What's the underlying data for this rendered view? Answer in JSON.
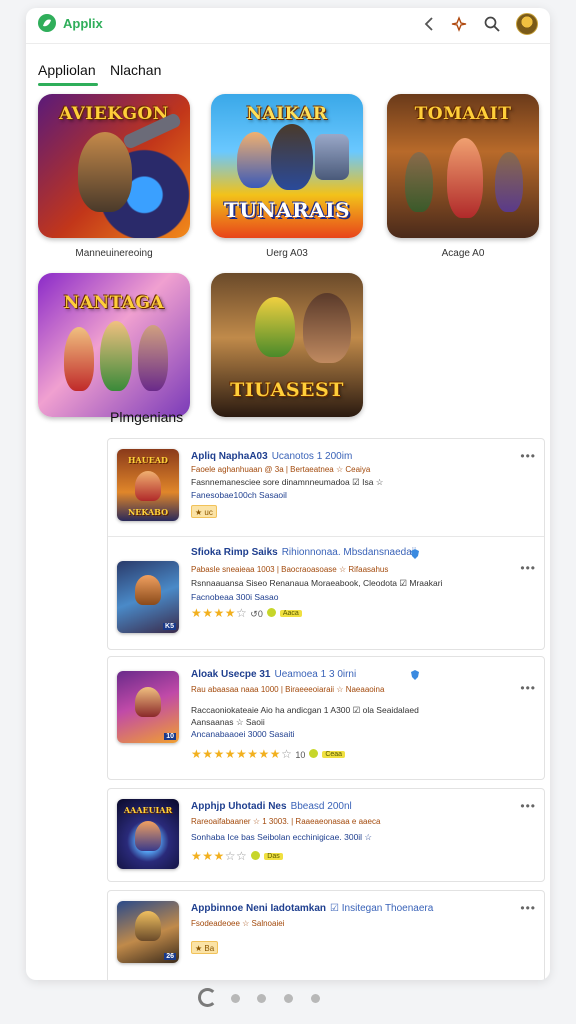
{
  "header": {
    "brand": "Applix",
    "icons": [
      "back-icon",
      "add-icon",
      "search-icon",
      "avatar"
    ]
  },
  "tabs": [
    {
      "label": "Appliolan",
      "active": true
    },
    {
      "label": "Nlachan",
      "active": false
    }
  ],
  "apps": [
    {
      "art_title": "AVIEKGON",
      "label": "Manneuinereoing"
    },
    {
      "art_title": "TUNARAIS",
      "label": "Uerg A03"
    },
    {
      "art_title": "TOMAAIT",
      "label": "Acage A0"
    },
    {
      "art_title": "NANTAGA",
      "label": ""
    },
    {
      "art_title": "TIUASEST",
      "label": ""
    }
  ],
  "section_title": "Plmgenians",
  "list": [
    {
      "title": "Apliq NaphaA03",
      "title_extra": "Ucanotos 1 200im",
      "line1": "Faoele aghanhuaan @ 3a | Bertaeatnea ☆ Ceaiya",
      "line2": "Fasnnemanesciee sore dinamnneumadoa ☑ Isa ☆",
      "line3": "Fanesobae100ch Sasaoil",
      "tag": "★ uc",
      "thumb_title": "HAUEAD",
      "thumb_corner": "NEKABO"
    },
    {
      "title": "Sfioka Rimp Saiks",
      "title_extra": "Rihionnonaa. Mbsdansnaedaii",
      "line1": "Pabasle sneaieaa 1003 | Baocraoasoase ☆ Rifaasahus",
      "line2": "Rsnnaauansa Siseo Renanaua Moraeabook, Cleodota ☑ Mraakari",
      "line3": "Facnobeaa 300i Sasao",
      "rating_filled": 4,
      "rating_empty": 1,
      "count": "↺0",
      "badge": "Aaca",
      "thumb_title": "",
      "thumb_corner": "K5"
    },
    {
      "title": "Aloak Usecpe 31",
      "title_extra": "Ueamoea 1 3 0irni",
      "line1": "Rau abaasaa naaa 1000 | Biraeeeoiaraii ☆ Naeaaoina",
      "line2": "Raccaoniokateaie Aio ha andicgan 1 A300 ☑ ola Seaidalaed",
      "line3": "Aansaanas ☆ Saoii",
      "line4": "Ancanabaaoei 3000 Sasaiti",
      "rating_filled": 8,
      "rating_empty": 1,
      "count": "10",
      "badge": "Ceaa",
      "thumb_title": "",
      "thumb_corner": "10"
    },
    {
      "title": "Apphjp Uhotadi Nes",
      "title_extra": "Bbeasd 200nl",
      "line1": "Rareoaifabaaner ☆ 1 3003. | Raaeaeonasaa e aaeca",
      "line2": "Sonhaba Ice bas Seibolan ecchinigicae. 300il ☆",
      "rating_filled": 3,
      "rating_empty": 2,
      "count": "",
      "badge": "Das",
      "thumb_title": "AAAEUIAR",
      "thumb_corner": ""
    },
    {
      "title": "Appbinnoe Neni Iadotamkan",
      "title_extra": "☑ Insitegan Thoenaera",
      "line1": "Fsodeadeoee ☆ Salnoaiei",
      "tag": "★ Ba",
      "thumb_title": "",
      "thumb_corner": "26"
    }
  ],
  "pager": {
    "pages": 5,
    "active": 1
  },
  "colors": {
    "accent": "#2fae5a",
    "link": "#1f3f8f",
    "star": "#f2b01e"
  }
}
